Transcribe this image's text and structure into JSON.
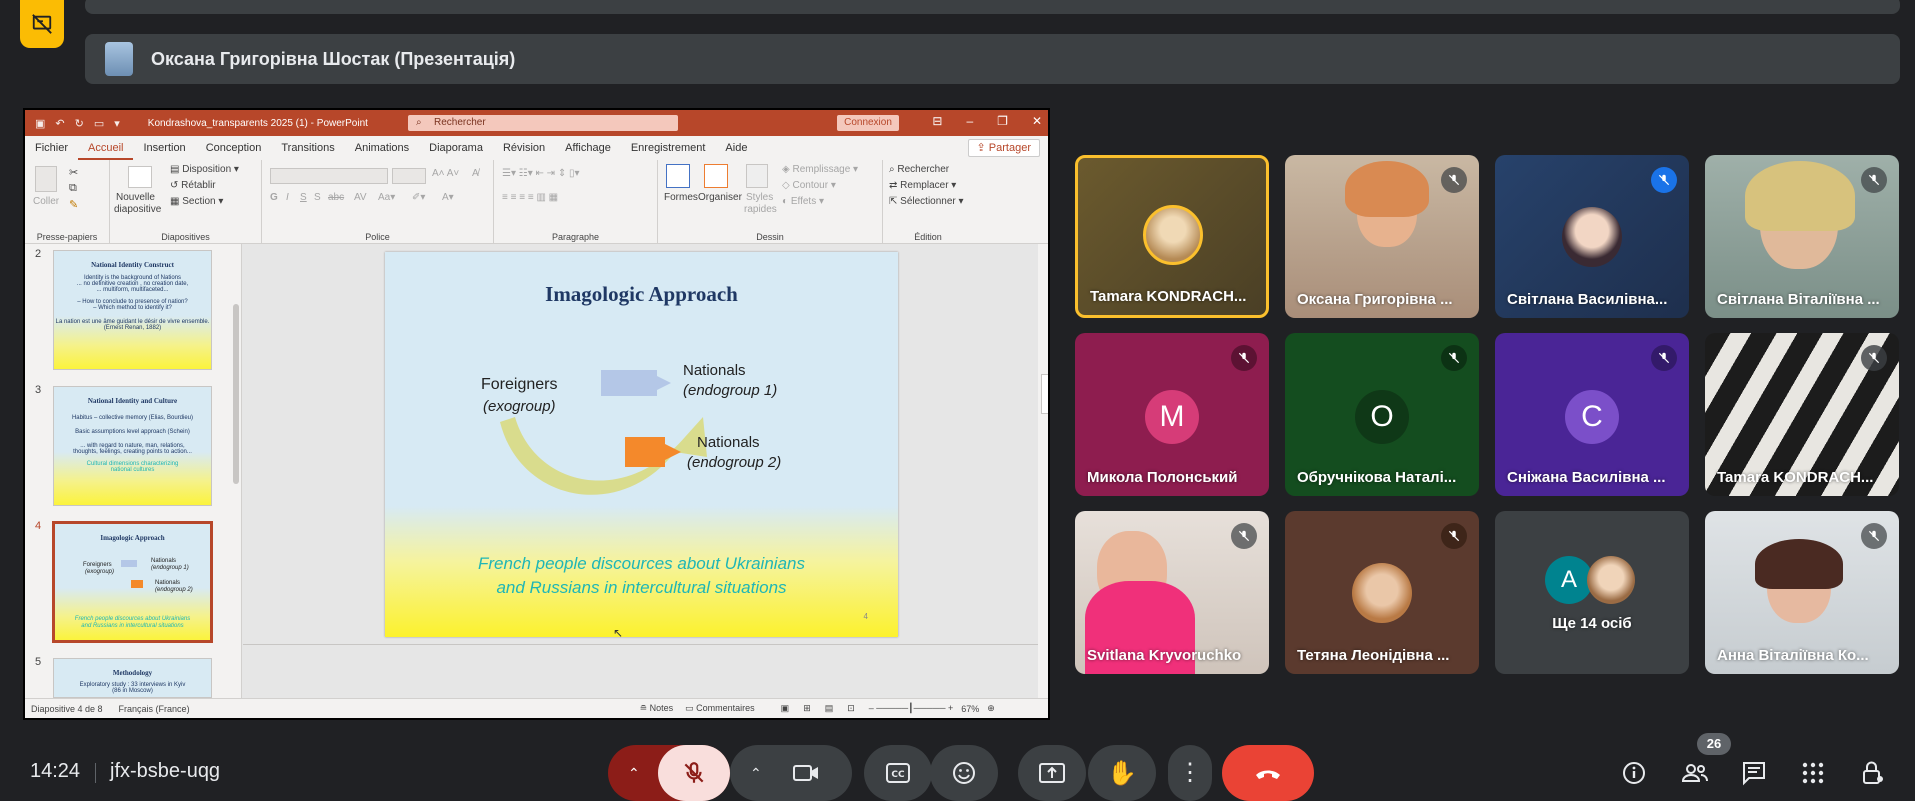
{
  "presenter": {
    "name": "Оксана Григорівна Шостак (Презентація)"
  },
  "ppt": {
    "document_title": "Kondrashova_transparents 2025 (1)  -  PowerPoint",
    "search_placeholder": "Rechercher",
    "connexion": "Connexion",
    "tabs": [
      "Fichier",
      "Accueil",
      "Insertion",
      "Conception",
      "Transitions",
      "Animations",
      "Diaporama",
      "Révision",
      "Affichage",
      "Enregistrement",
      "Aide"
    ],
    "share": "Partager",
    "ribbon": {
      "coller": "Coller",
      "presse_papiers": "Presse-papiers",
      "nouvelle": "Nouvelle",
      "diapositive": "diapositive",
      "disposition": "Disposition",
      "retablir": "Rétablir",
      "section": "Section",
      "diapositives": "Diapositives",
      "police": "Police",
      "paragraphe": "Paragraphe",
      "formes": "Formes",
      "organiser": "Organiser",
      "styles": "Styles",
      "rapides": "rapides",
      "remplissage": "Remplissage",
      "contour": "Contour",
      "effets": "Effets",
      "dessin": "Dessin",
      "rechercher": "Rechercher",
      "remplacer": "Remplacer",
      "selectionner": "Sélectionner",
      "edition": "Édition"
    },
    "thumbnails": [
      {
        "num": "2",
        "title": "National Identity Construct",
        "lines": [
          "Identity is the background of Nations",
          "... no definitive creation , no creation date,",
          "... multiform, multifaceted...",
          "– How to conclude to presence of nation?",
          "– Which method to identify it?",
          "La nation est une âme guidant le désir de vivre ensemble.",
          "(Ernest Renan, 1882)"
        ]
      },
      {
        "num": "3",
        "title": "National Identity and Culture",
        "lines": [
          "Habitus – collective memory (Elias, Bourdieu)",
          "Basic assumptions level approach (Schein)",
          "... with regard to nature, man, relations, thoughts, feelings, creating points to action...",
          "Cultural dimensions characterizing national cultures"
        ]
      },
      {
        "num": "4",
        "title": "Imagologic Approach",
        "lines": [
          "Foreigners",
          "(exogroup)",
          "Nationals",
          "(endogroup 1)",
          "Nationals",
          "(endogroup 2)",
          "French people discources about Ukrainians",
          "and Russians in intercultural situations"
        ]
      },
      {
        "num": "5",
        "title": "Methodology",
        "lines": [
          "Exploratory study : 33 interviews in Kyiv",
          "(86 in Moscow)"
        ]
      }
    ],
    "slide": {
      "title": "Imagologic Approach",
      "foreigners": "Foreigners",
      "exogroup": "(exogroup)",
      "nationals1": "Nationals",
      "endogroup1": "(endogroup 1)",
      "nationals2": "Nationals",
      "endogroup2": "(endogroup 2)",
      "caption1": "French people discources about Ukrainians",
      "caption2": "and Russians in intercultural situations",
      "page": "4"
    },
    "status": {
      "slide_of": "Diapositive 4 de 8",
      "language": "Français (France)",
      "notes": "Notes",
      "comments": "Commentaires",
      "zoom": "67%"
    }
  },
  "participants": [
    {
      "name": "Tamara KONDRACH...",
      "kind": "photo",
      "active": true
    },
    {
      "name": "Оксана Григорівна ...",
      "kind": "video"
    },
    {
      "name": "Світлана Василівна...",
      "kind": "photo"
    },
    {
      "name": "Світлана Віталіївна ...",
      "kind": "video"
    },
    {
      "name": "Микола Полонський",
      "kind": "letter",
      "letter": "M"
    },
    {
      "name": "Обручнікова Наталі...",
      "kind": "letter",
      "letter": "O"
    },
    {
      "name": "Сніжана Василівна ...",
      "kind": "letter",
      "letter": "C"
    },
    {
      "name": "Tamara KONDRACH...",
      "kind": "video"
    },
    {
      "name": "Svitlana Kryvoruchko",
      "kind": "video"
    },
    {
      "name": "Тетяна Леонідівна ...",
      "kind": "photo"
    },
    {
      "name": "Ще 14 осіб",
      "kind": "more",
      "letter": "A"
    },
    {
      "name": "Анна Віталіївна Ко...",
      "kind": "video"
    }
  ],
  "footer": {
    "time": "14:24",
    "meeting_code": "jfx-bsbe-uqg",
    "people_count": "26"
  },
  "colors": {
    "meet_bg": "#202124",
    "ppt_accent": "#b7472a",
    "end_call": "#ea4335",
    "mic_off": "#f28b82"
  }
}
